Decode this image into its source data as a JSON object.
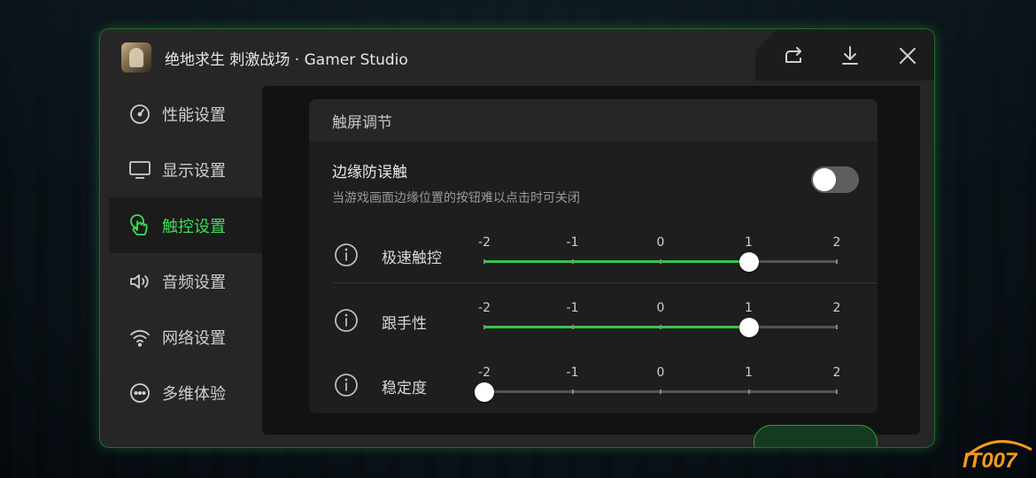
{
  "app": {
    "title": "绝地求生 刺激战场 · Gamer Studio"
  },
  "sidebar": {
    "items": [
      {
        "label": "性能设置",
        "icon": "gauge-icon"
      },
      {
        "label": "显示设置",
        "icon": "monitor-icon"
      },
      {
        "label": "触控设置",
        "icon": "touch-hand-icon",
        "active": true
      },
      {
        "label": "音频设置",
        "icon": "speaker-icon"
      },
      {
        "label": "网络设置",
        "icon": "wifi-icon"
      },
      {
        "label": "多维体验",
        "icon": "more-dots-icon"
      }
    ]
  },
  "card": {
    "header": "触屏调节",
    "edge": {
      "title": "边缘防误触",
      "desc": "当游戏画面边缘位置的按钮难以点击时可关闭",
      "enabled": false
    },
    "sliders": [
      {
        "label": "极速触控",
        "ticks": [
          "-2",
          "-1",
          "0",
          "1",
          "2"
        ],
        "value": 1,
        "min": -2,
        "max": 2
      },
      {
        "label": "跟手性",
        "ticks": [
          "-2",
          "-1",
          "0",
          "1",
          "2"
        ],
        "value": 1,
        "min": -2,
        "max": 2
      },
      {
        "label": "稳定度",
        "ticks": [
          "-2",
          "-1",
          "0",
          "1",
          "2"
        ],
        "value": -2,
        "min": -2,
        "max": 2
      }
    ]
  },
  "watermark": {
    "text": "IT007"
  },
  "colors": {
    "accent": "#35c64c",
    "active_text": "#3ddc57"
  }
}
